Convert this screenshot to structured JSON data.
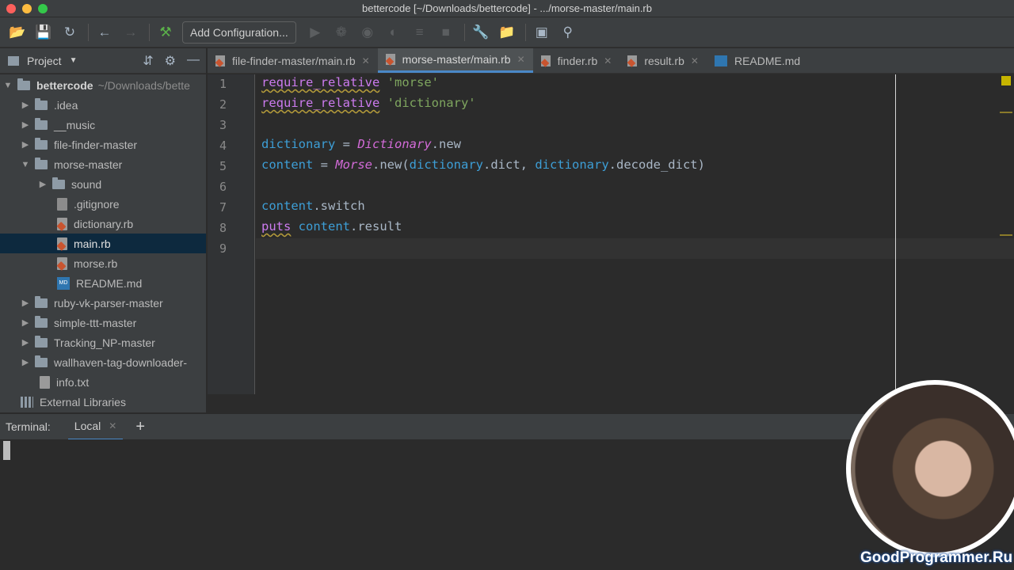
{
  "window": {
    "title": "bettercode [~/Downloads/bettercode] - .../morse-master/main.rb"
  },
  "toolbar": {
    "config_label": "Add Configuration...",
    "icons": [
      "open-folder-icon",
      "save-icon",
      "sync-icon",
      "back-icon",
      "forward-icon",
      "build-hammer-icon",
      "run-icon",
      "debug-icon",
      "coverage-icon",
      "profile-icon",
      "concurrency-icon",
      "stop-icon",
      "settings-wrench-icon",
      "project-structure-icon",
      "terminal-icon",
      "search-icon"
    ]
  },
  "project": {
    "header": "Project",
    "tree": [
      {
        "label": "bettercode",
        "path": "~/Downloads/bette",
        "type": "root",
        "expanded": true
      },
      {
        "label": ".idea",
        "type": "folder"
      },
      {
        "label": "__music",
        "type": "folder"
      },
      {
        "label": "file-finder-master",
        "type": "folder"
      },
      {
        "label": "morse-master",
        "type": "folder",
        "expanded": true
      },
      {
        "label": "sound",
        "type": "folder"
      },
      {
        "label": ".gitignore",
        "type": "git"
      },
      {
        "label": "dictionary.rb",
        "type": "rb"
      },
      {
        "label": "main.rb",
        "type": "rb",
        "selected": true
      },
      {
        "label": "morse.rb",
        "type": "rb"
      },
      {
        "label": "README.md",
        "type": "md"
      },
      {
        "label": "ruby-vk-parser-master",
        "type": "folder"
      },
      {
        "label": "simple-ttt-master",
        "type": "folder"
      },
      {
        "label": "Tracking_NP-master",
        "type": "folder"
      },
      {
        "label": "wallhaven-tag-downloader-",
        "type": "folder"
      },
      {
        "label": "info.txt",
        "type": "txt"
      },
      {
        "label": "External Libraries",
        "type": "lib"
      }
    ]
  },
  "tabs": [
    {
      "label": "file-finder-master/main.rb",
      "type": "rb"
    },
    {
      "label": "morse-master/main.rb",
      "type": "rb",
      "active": true
    },
    {
      "label": "finder.rb",
      "type": "rb"
    },
    {
      "label": "result.rb",
      "type": "rb"
    },
    {
      "label": "README.md",
      "type": "md"
    }
  ],
  "editor": {
    "line_numbers": [
      "1",
      "2",
      "3",
      "4",
      "5",
      "6",
      "7",
      "8",
      "9"
    ],
    "lines": [
      [
        [
          "kw",
          "require_relative"
        ],
        [
          "plain",
          " "
        ],
        [
          "str",
          "'morse'"
        ]
      ],
      [
        [
          "kw",
          "require_relative"
        ],
        [
          "plain",
          " "
        ],
        [
          "str",
          "'dictionary'"
        ]
      ],
      [],
      [
        [
          "var",
          "dictionary"
        ],
        [
          "plain",
          " = "
        ],
        [
          "cls",
          "Dictionary"
        ],
        [
          "plain",
          ".new"
        ]
      ],
      [
        [
          "var",
          "content"
        ],
        [
          "plain",
          " = "
        ],
        [
          "cls",
          "Morse"
        ],
        [
          "plain",
          ".new("
        ],
        [
          "var",
          "dictionary"
        ],
        [
          "plain",
          ".dict, "
        ],
        [
          "var",
          "dictionary"
        ],
        [
          "plain",
          ".decode_dict)"
        ]
      ],
      [],
      [
        [
          "var",
          "content"
        ],
        [
          "plain",
          ".switch"
        ]
      ],
      [
        [
          "kw",
          "puts"
        ],
        [
          "plain",
          " "
        ],
        [
          "var",
          "content"
        ],
        [
          "plain",
          ".result"
        ]
      ],
      []
    ]
  },
  "terminal": {
    "title": "Terminal:",
    "tab_label": "Local",
    "add_label": "+"
  },
  "watermark": "GoodProgrammer.Ru"
}
